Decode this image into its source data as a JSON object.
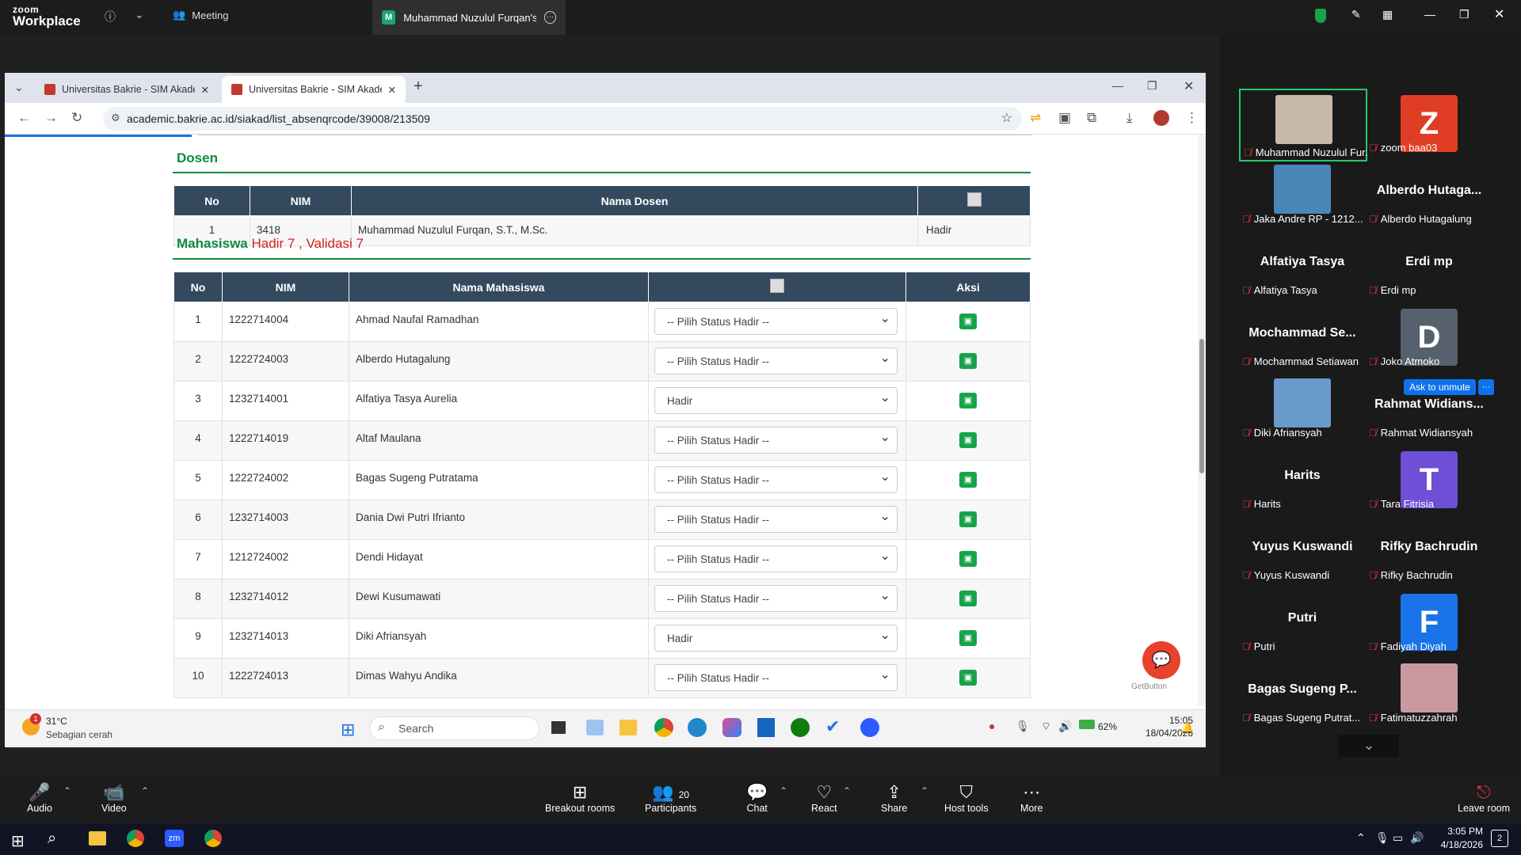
{
  "zoom_top": {
    "logo_line1": "zoom",
    "logo_line2": "Workplace",
    "meeting_label": "Meeting",
    "share_tab_label": "Muhammad Nuzulul Furqan's scr",
    "share_badge": "M"
  },
  "browser": {
    "tabs": [
      {
        "title": "Universitas Bakrie - SIM Akaden"
      },
      {
        "title": "Universitas Bakrie - SIM Akaden"
      }
    ],
    "url": "academic.bakrie.ac.id/siakad/list_absenqrcode/39008/213509"
  },
  "dosen_section": {
    "title": "Dosen",
    "headers": [
      "No",
      "NIM",
      "Nama Dosen"
    ],
    "rows": [
      {
        "no": "1",
        "nim": "3418",
        "nama": "Muhammad Nuzulul Furqan, S.T., M.Sc.",
        "status": "Hadir"
      }
    ]
  },
  "mahasiswa_section": {
    "title": "Mahasiswa",
    "hadir_text": "Hadir 7 , Validasi 7",
    "headers": [
      "No",
      "NIM",
      "Nama Mahasiswa",
      "Aksi"
    ],
    "rows": [
      {
        "no": "1",
        "nim": "1222714004",
        "nama": "Ahmad Naufal Ramadhan",
        "status": "-- Pilih Status Hadir --"
      },
      {
        "no": "2",
        "nim": "1222724003",
        "nama": "Alberdo Hutagalung",
        "status": "-- Pilih Status Hadir --"
      },
      {
        "no": "3",
        "nim": "1232714001",
        "nama": "Alfatiya Tasya Aurelia",
        "status": "Hadir"
      },
      {
        "no": "4",
        "nim": "1222714019",
        "nama": "Altaf Maulana",
        "status": "-- Pilih Status Hadir --"
      },
      {
        "no": "5",
        "nim": "1222724002",
        "nama": "Bagas Sugeng Putratama",
        "status": "-- Pilih Status Hadir --"
      },
      {
        "no": "6",
        "nim": "1232714003",
        "nama": "Dania Dwi Putri Ifrianto",
        "status": "-- Pilih Status Hadir --"
      },
      {
        "no": "7",
        "nim": "1212724002",
        "nama": "Dendi Hidayat",
        "status": "-- Pilih Status Hadir --"
      },
      {
        "no": "8",
        "nim": "1232714012",
        "nama": "Dewi Kusumawati",
        "status": "-- Pilih Status Hadir --"
      },
      {
        "no": "9",
        "nim": "1232714013",
        "nama": "Diki Afriansyah",
        "status": "Hadir"
      },
      {
        "no": "10",
        "nim": "1222724013",
        "nama": "Dimas Wahyu Andika",
        "status": "-- Pilih Status Hadir --"
      }
    ]
  },
  "getbutton_label": "GetButton",
  "inner_taskbar": {
    "weather_temp": "31°C",
    "weather_desc": "Sebagian cerah",
    "weather_badge": "1",
    "search_placeholder": "Search",
    "battery": "62%",
    "time": "15:05",
    "date": "18/04/2026"
  },
  "gallery": {
    "tiles": [
      {
        "display": "",
        "label": "Muhammad Nuzulul Fur...",
        "kind": "photo",
        "photo_color": "#c8b8a8",
        "active": true
      },
      {
        "display": "Z",
        "label": "zoom baa03",
        "kind": "avatar",
        "color": "#e03e24"
      },
      {
        "display": "",
        "label": "Jaka Andre RP - 1212...",
        "kind": "photo",
        "photo_color": "#4a86b8"
      },
      {
        "display": "Alberdo  Hutaga...",
        "label": "Alberdo Hutagalung",
        "kind": "name"
      },
      {
        "display": "Alfatiya Tasya",
        "label": "Alfatiya Tasya",
        "kind": "name"
      },
      {
        "display": "Erdi mp",
        "label": "Erdi mp",
        "kind": "name"
      },
      {
        "display": "Mochammad  Se...",
        "label": "Mochammad Setiawan",
        "kind": "name"
      },
      {
        "display": "D",
        "label": "Joko Atmoko",
        "kind": "avatar",
        "color": "#56606e"
      },
      {
        "display": "",
        "label": "Diki Afriansyah",
        "kind": "photo",
        "photo_color": "#6a9ac8"
      },
      {
        "display": "Rahmat  Widians...",
        "label": "Rahmat Widiansyah",
        "kind": "name"
      },
      {
        "display": "Harits",
        "label": "Harits",
        "kind": "name"
      },
      {
        "display": "T",
        "label": "Tara Fitrisia",
        "kind": "avatar",
        "color": "#6e4fd6"
      },
      {
        "display": "Yuyus Kuswandi",
        "label": "Yuyus Kuswandi",
        "kind": "name"
      },
      {
        "display": "Rifky Bachrudin",
        "label": "Rifky Bachrudin",
        "kind": "name"
      },
      {
        "display": "Putri",
        "label": "Putri",
        "kind": "name"
      },
      {
        "display": "F",
        "label": "Fadiyah Diyah",
        "kind": "avatar",
        "color": "#1a73e8"
      },
      {
        "display": "Bagas Sugeng  P...",
        "label": "Bagas Sugeng Putrat...",
        "kind": "name"
      },
      {
        "display": "",
        "label": "Fatimatuzzahrah",
        "kind": "photo",
        "photo_color": "#c89aa0"
      }
    ],
    "ask_unmute": "Ask to unmute",
    "more_dots": "···"
  },
  "zoom_controls": {
    "audio": "Audio",
    "video": "Video",
    "breakout": "Breakout rooms",
    "participants": "Participants",
    "participants_count": "20",
    "chat": "Chat",
    "react": "React",
    "share": "Share",
    "host_tools": "Host tools",
    "more": "More",
    "leave": "Leave room"
  },
  "win_taskbar": {
    "time": "3:05 PM",
    "date": "4/18/2026",
    "notif_count": "2"
  }
}
